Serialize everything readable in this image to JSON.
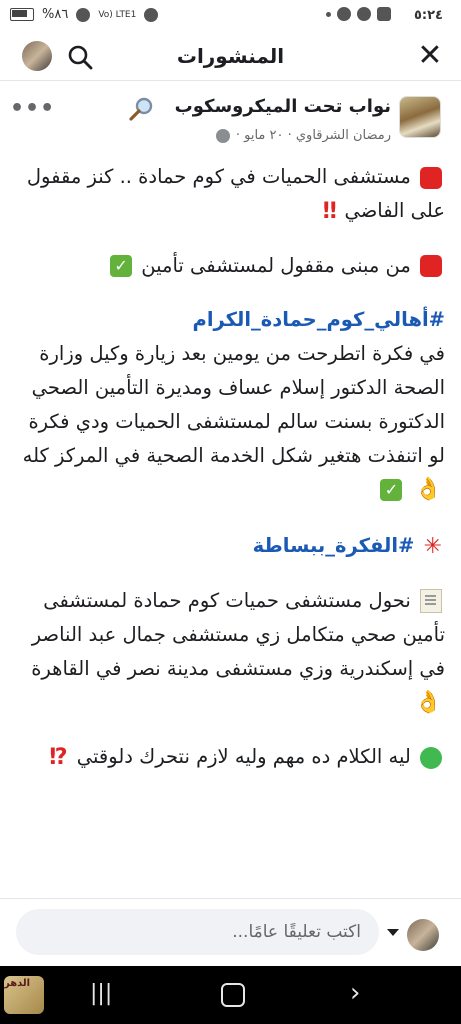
{
  "status_bar": {
    "time": "٥:٢٤",
    "battery": "%٨٦",
    "network_label": "Vo) LTE1"
  },
  "header": {
    "title": "المنشورات"
  },
  "post": {
    "page_name": "نواب تحت الميكروسكوب",
    "meta": "رمضان الشرقاوي · ٢٠ مايو ·",
    "paragraphs": {
      "p1_text": "مستشفى الحميات في كوم حمادة .. كنز مقفول على الفاضي",
      "p2_text": "من مبنى مقفول لمستشفى تأمين",
      "hashtag1": "#أهالي_كوم_حمادة_الكرام",
      "p3_text": "في فكرة اتطرحت من يومين بعد زيارة وكيل وزارة الصحة الدكتور إسلام عساف ومديرة التأمين الصحي الدكتورة بسنت سالم لمستشفى الحميات ودي فكرة لو اتنفذت هتغير شكل الخدمة الصحية في المركز كله",
      "hashtag2": "#الفكرة_ببساطة",
      "p4_text": "نحول مستشفى حميات كوم حمادة لمستشفى تأمين صحي متكامل زي مستشفى جمال عبد الناصر في إسكندرية وزي مستشفى مدينة نصر في القاهرة",
      "p5_text": "ليه الكلام ده مهم وليه لازم نتحرك دلوقتي"
    }
  },
  "comment": {
    "placeholder": "اكتب تعليقًا عامًا..."
  },
  "nav": {
    "app_label": "الدهر"
  },
  "icons": [
    "close-icon",
    "search-icon",
    "magnifier-emoji-icon",
    "globe-icon",
    "more-icon",
    "red-square-icon",
    "double-exclamation-icon",
    "check-mark-icon",
    "ok-hand-icon",
    "anger-icon",
    "memo-icon",
    "green-circle-icon",
    "exclamation-question-icon",
    "dropdown-caret-icon",
    "recents-icon",
    "home-icon",
    "back-icon"
  ]
}
